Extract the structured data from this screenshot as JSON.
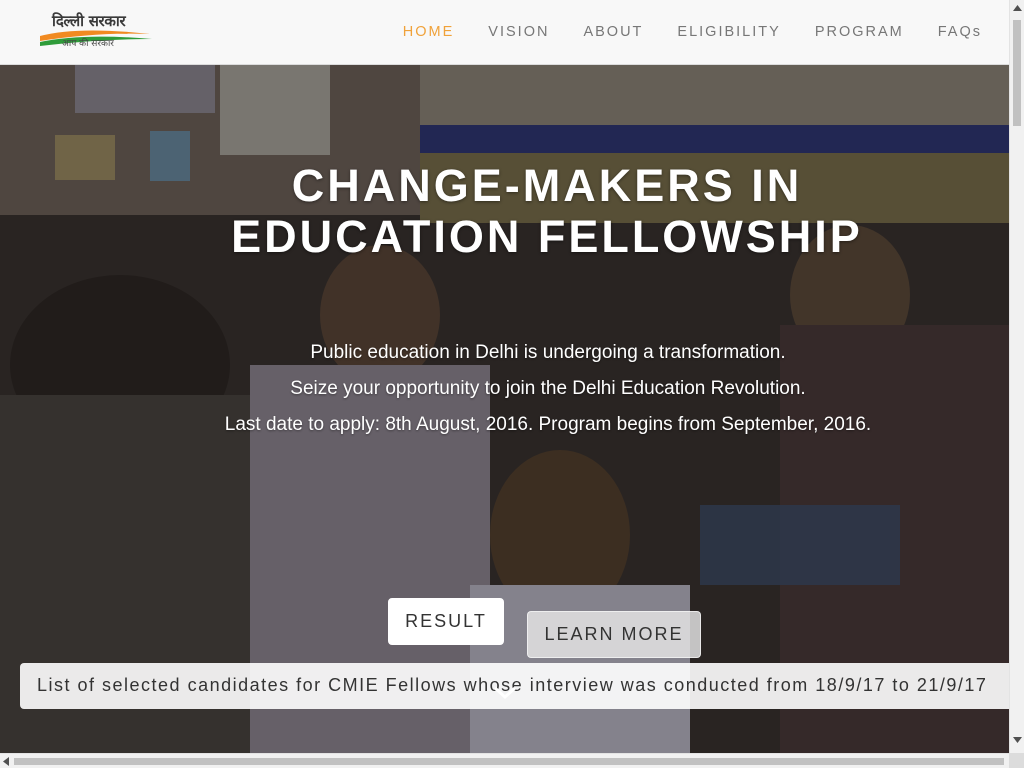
{
  "header": {
    "logo": {
      "title": "दिल्ली सरकार",
      "tagline": "आप की सरकार"
    },
    "nav": [
      {
        "label": "HOME",
        "active": true
      },
      {
        "label": "VISION",
        "active": false
      },
      {
        "label": "ABOUT",
        "active": false
      },
      {
        "label": "ELIGIBILITY",
        "active": false
      },
      {
        "label": "PROGRAM",
        "active": false
      },
      {
        "label": "FAQs",
        "active": false
      }
    ]
  },
  "hero": {
    "title_line1": "CHANGE-MAKERS IN",
    "title_line2": "EDUCATION FELLOWSHIP",
    "lines": [
      "Public education in Delhi is undergoing a transformation.",
      "Seize your opportunity to join the Delhi Education Revolution.",
      "Last date to apply: 8th August, 2016. Program begins from September, 2016."
    ],
    "buttons": {
      "result": "RESULT",
      "learn_more": "LEARN MORE"
    },
    "ticker": "List of selected candidates for CMIE Fellows whose interview was conducted from 18/9/17 to 21/9/17"
  },
  "icons": {
    "scroll_down": "chevron-down-icon"
  },
  "colors": {
    "accent": "#f0a23a",
    "nav_text": "#777777",
    "header_bg": "#f8f8f8"
  }
}
